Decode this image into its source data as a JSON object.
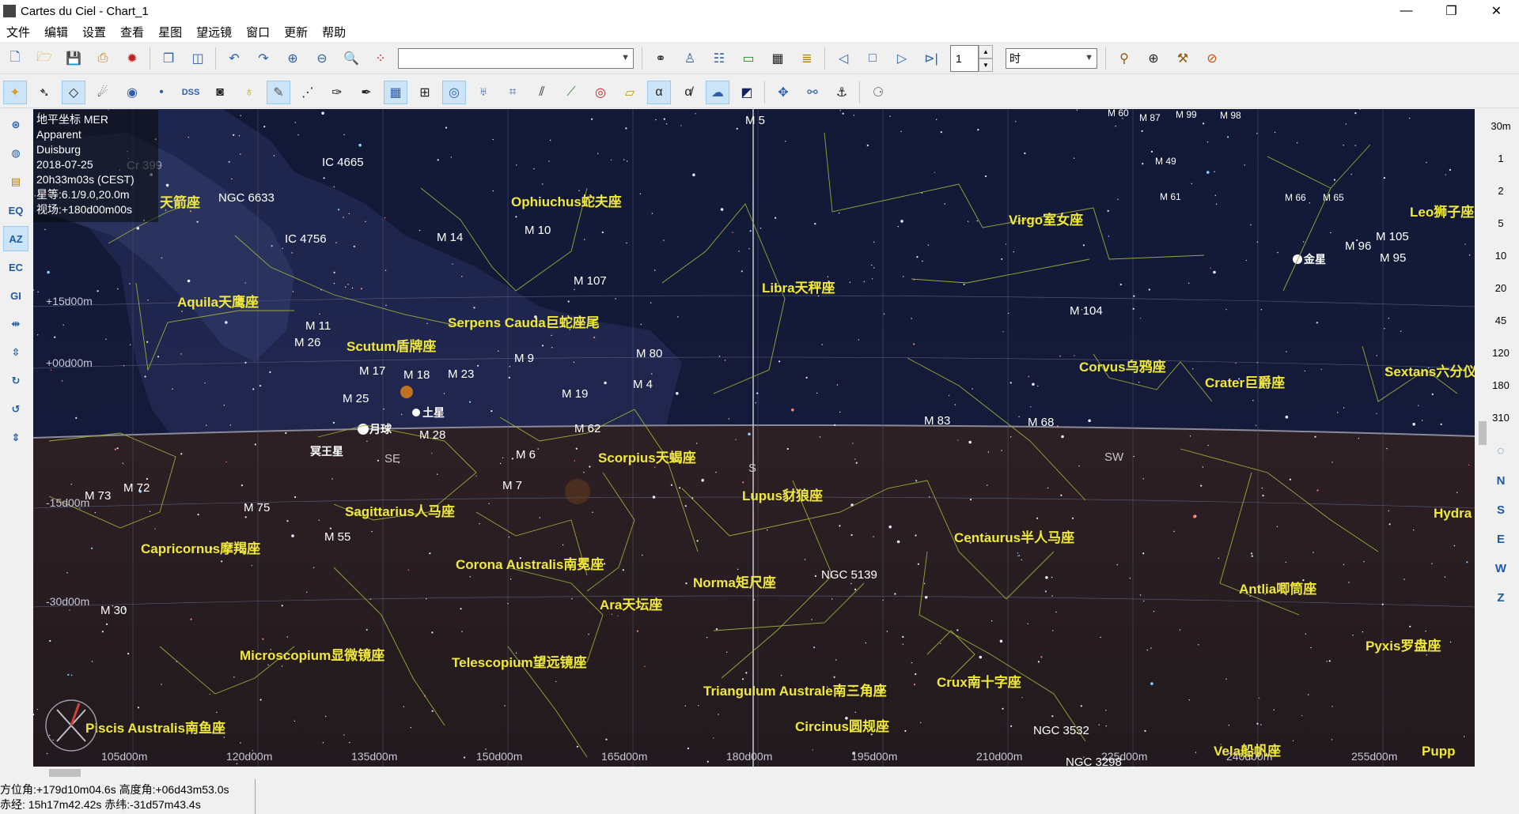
{
  "window": {
    "title": "Cartes du Ciel - Chart_1",
    "minimize": "—",
    "restore": "❐",
    "close": "✕"
  },
  "menu": [
    "文件",
    "编辑",
    "设置",
    "查看",
    "星图",
    "望远镜",
    "窗口",
    "更新",
    "帮助"
  ],
  "toolbar1": {
    "search_value": "",
    "step_value": "1",
    "unit_value": "时"
  },
  "infobox": {
    "lines": [
      "地平坐标 MER",
      "Apparent",
      "Duisburg",
      "2018-07-25",
      "20h33m03s (CEST)",
      "星等:6.1/9.0,20.0m",
      "视场:+180d00m00s"
    ]
  },
  "right_toolbar": {
    "zoom_levels": [
      "30m",
      "1",
      "2",
      "5",
      "10",
      "20",
      "45",
      "120",
      "180",
      "310"
    ],
    "directions": [
      "N",
      "S",
      "E",
      "W",
      "Z"
    ]
  },
  "left_toolbar": {
    "buttons": [
      "EQ",
      "AZ",
      "EC",
      "GI"
    ]
  },
  "chart": {
    "altitude_labels": [
      "+15d00m",
      "+00d00m",
      "-15d00m",
      "-30d00m"
    ],
    "azimuth_labels": [
      "105d00m",
      "120d00m",
      "135d00m",
      "150d00m",
      "165d00m",
      "180d00m",
      "195d00m",
      "210d00m",
      "225d00m",
      "240d00m",
      "255d00m"
    ],
    "horizon_cardinals": [
      "SE",
      "S",
      "SW"
    ],
    "constellations": [
      "天箭座",
      "Ophiuchus蛇夫座",
      "Aquila天鹰座",
      "Scutum盾牌座",
      "Serpens Cauda巨蛇座尾",
      "Libra天秤座",
      "Virgo室女座",
      "Leo狮子座",
      "Corvus乌鸦座",
      "Crater巨爵座",
      "Sextans六分仪",
      "Scorpius天蝎座",
      "Sagittarius人马座",
      "Capricornus摩羯座",
      "Lupus豺狼座",
      "Centaurus半人马座",
      "Hydra",
      "Corona Australis南冕座",
      "Norma矩尺座",
      "Antlia唧筒座",
      "Ara天坛座",
      "Microscopium显微镜座",
      "Telescopium望远镜座",
      "Pyxis罗盘座",
      "Triangulum Australe南三角座",
      "Crux南十字座",
      "Piscis Australis南鱼座",
      "Circinus圆规座",
      "Vela船帆座",
      "Pupp"
    ],
    "objects": [
      "M 5",
      "M 60",
      "M 87",
      "M 99",
      "M 98",
      "M 49",
      "M 61",
      "M 66",
      "M 65",
      "M 96",
      "M 105",
      "M 95",
      "M 104",
      "M 83",
      "M 68",
      "IC 4665",
      "NGC 6633",
      "IC 4756",
      "M 14",
      "M 10",
      "M 107",
      "M 11",
      "M 26",
      "M 17",
      "M 18",
      "M 23",
      "M 25",
      "M 28",
      "M 9",
      "M 80",
      "M 4",
      "M 19",
      "M 62",
      "M 6",
      "M 7",
      "M 73",
      "M 72",
      "M 75",
      "M 55",
      "M 30",
      "NGC 5139",
      "NGC 3532",
      "NGC 3298",
      "Cr 399"
    ],
    "planets": [
      "金星",
      "土星",
      "月球",
      "冥王星"
    ]
  },
  "status": {
    "line1": "方位角:+179d10m04.6s 高度角:+06d43m53.0s",
    "line2": "赤经: 15h17m42.42s 赤纬:-31d57m43.4s"
  }
}
